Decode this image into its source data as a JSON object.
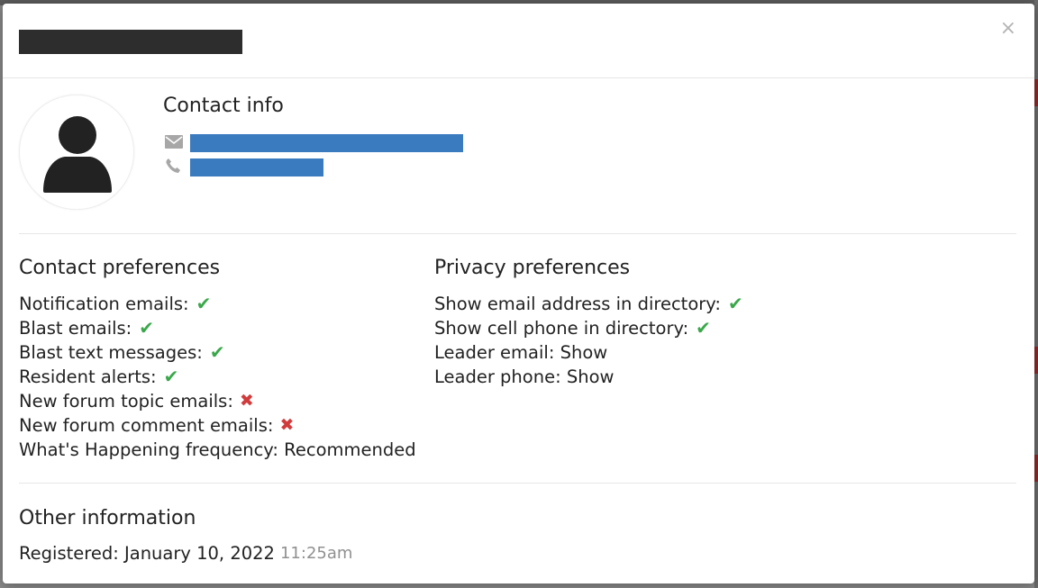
{
  "modal": {
    "close_label": "×"
  },
  "contact_info": {
    "title": "Contact info",
    "email_icon": "envelope-icon",
    "phone_icon": "phone-icon"
  },
  "contact_preferences": {
    "title": "Contact preferences",
    "items": [
      {
        "label": "Notification emails:",
        "status": "check"
      },
      {
        "label": "Blast emails:",
        "status": "check"
      },
      {
        "label": "Blast text messages:",
        "status": "check"
      },
      {
        "label": "Resident alerts:",
        "status": "check"
      },
      {
        "label": "New forum topic emails:",
        "status": "cross"
      },
      {
        "label": "New forum comment emails:",
        "status": "cross"
      },
      {
        "label": "What's Happening frequency: Recommended",
        "status": ""
      }
    ]
  },
  "privacy_preferences": {
    "title": "Privacy preferences",
    "items": [
      {
        "label": "Show email address in directory:",
        "status": "check"
      },
      {
        "label": "Show cell phone in directory:",
        "status": "check"
      },
      {
        "label": "Leader email: Show",
        "status": ""
      },
      {
        "label": "Leader phone: Show",
        "status": ""
      }
    ]
  },
  "other_information": {
    "title": "Other information",
    "registered_label": "Registered: January 10, 2022",
    "registered_time": "11:25am"
  },
  "colors": {
    "check": "#3aa84a",
    "cross": "#d23b3b",
    "link": "#3a7bbf"
  }
}
